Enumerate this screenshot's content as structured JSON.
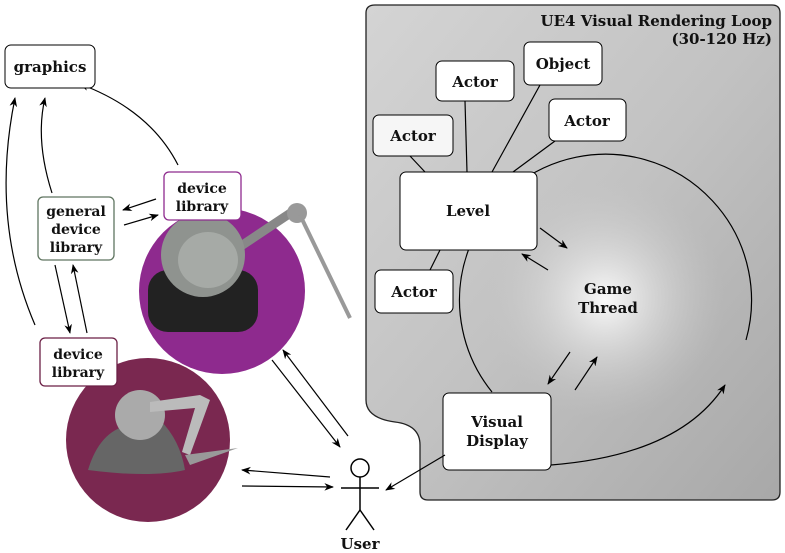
{
  "panel": {
    "title_line1": "UE4 Visual Rendering Loop",
    "title_line2": "(30-120 Hz)"
  },
  "nodes": {
    "graphics": "graphics",
    "general_device_library": [
      "general",
      "device",
      "library"
    ],
    "device_library_top": [
      "device",
      "library"
    ],
    "device_library_bottom": [
      "device",
      "library"
    ],
    "actor1": "Actor",
    "actor2": "Actor",
    "object": "Object",
    "actor3": "Actor",
    "level": "Level",
    "actor4": "Actor",
    "game_thread": [
      "Game",
      "Thread"
    ],
    "visual_display": [
      "Visual",
      "Display"
    ],
    "user": "User"
  },
  "colors": {
    "device_top_circle": "#8e2a8e",
    "device_bottom_circle": "#7a2850",
    "general_border": "#5f7560",
    "device_top_border": "#8e2a8e",
    "device_bottom_border": "#6b1f45"
  }
}
